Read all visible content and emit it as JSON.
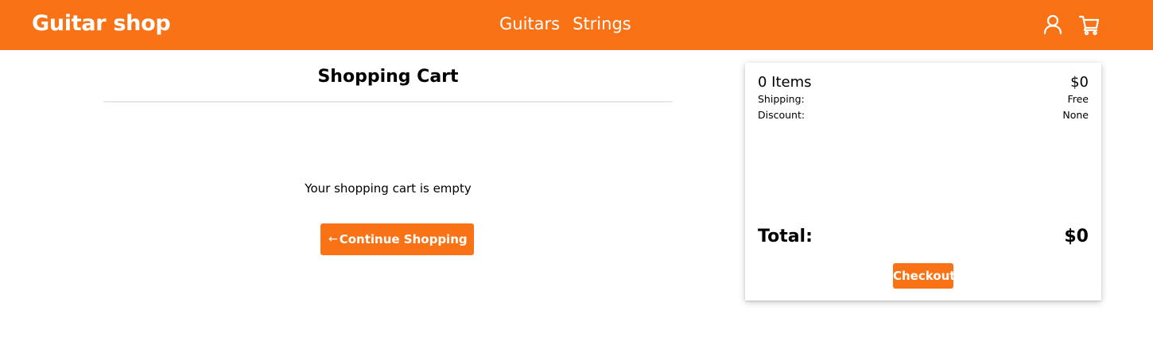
{
  "colors": {
    "brand": "#f97316",
    "nav_text": "#ffffff",
    "divider": "#e5e7eb"
  },
  "navbar": {
    "brand": "Guitar shop",
    "links": [
      {
        "label": "Guitars"
      },
      {
        "label": "Strings"
      }
    ],
    "icons": [
      "user-icon",
      "cart-icon"
    ]
  },
  "cart": {
    "title": "Shopping Cart",
    "empty_message": "Your shopping cart is empty",
    "continue_label": "Continue Shopping",
    "continue_icon": "arrow-left-icon"
  },
  "summary": {
    "items_label": "0 Items",
    "items_value": "$0",
    "shipping_label": "Shipping:",
    "shipping_value": "Free",
    "discount_label": "Discount:",
    "discount_value": "None",
    "total_label": "Total:",
    "total_value": "$0",
    "checkout_label": "Checkout"
  }
}
